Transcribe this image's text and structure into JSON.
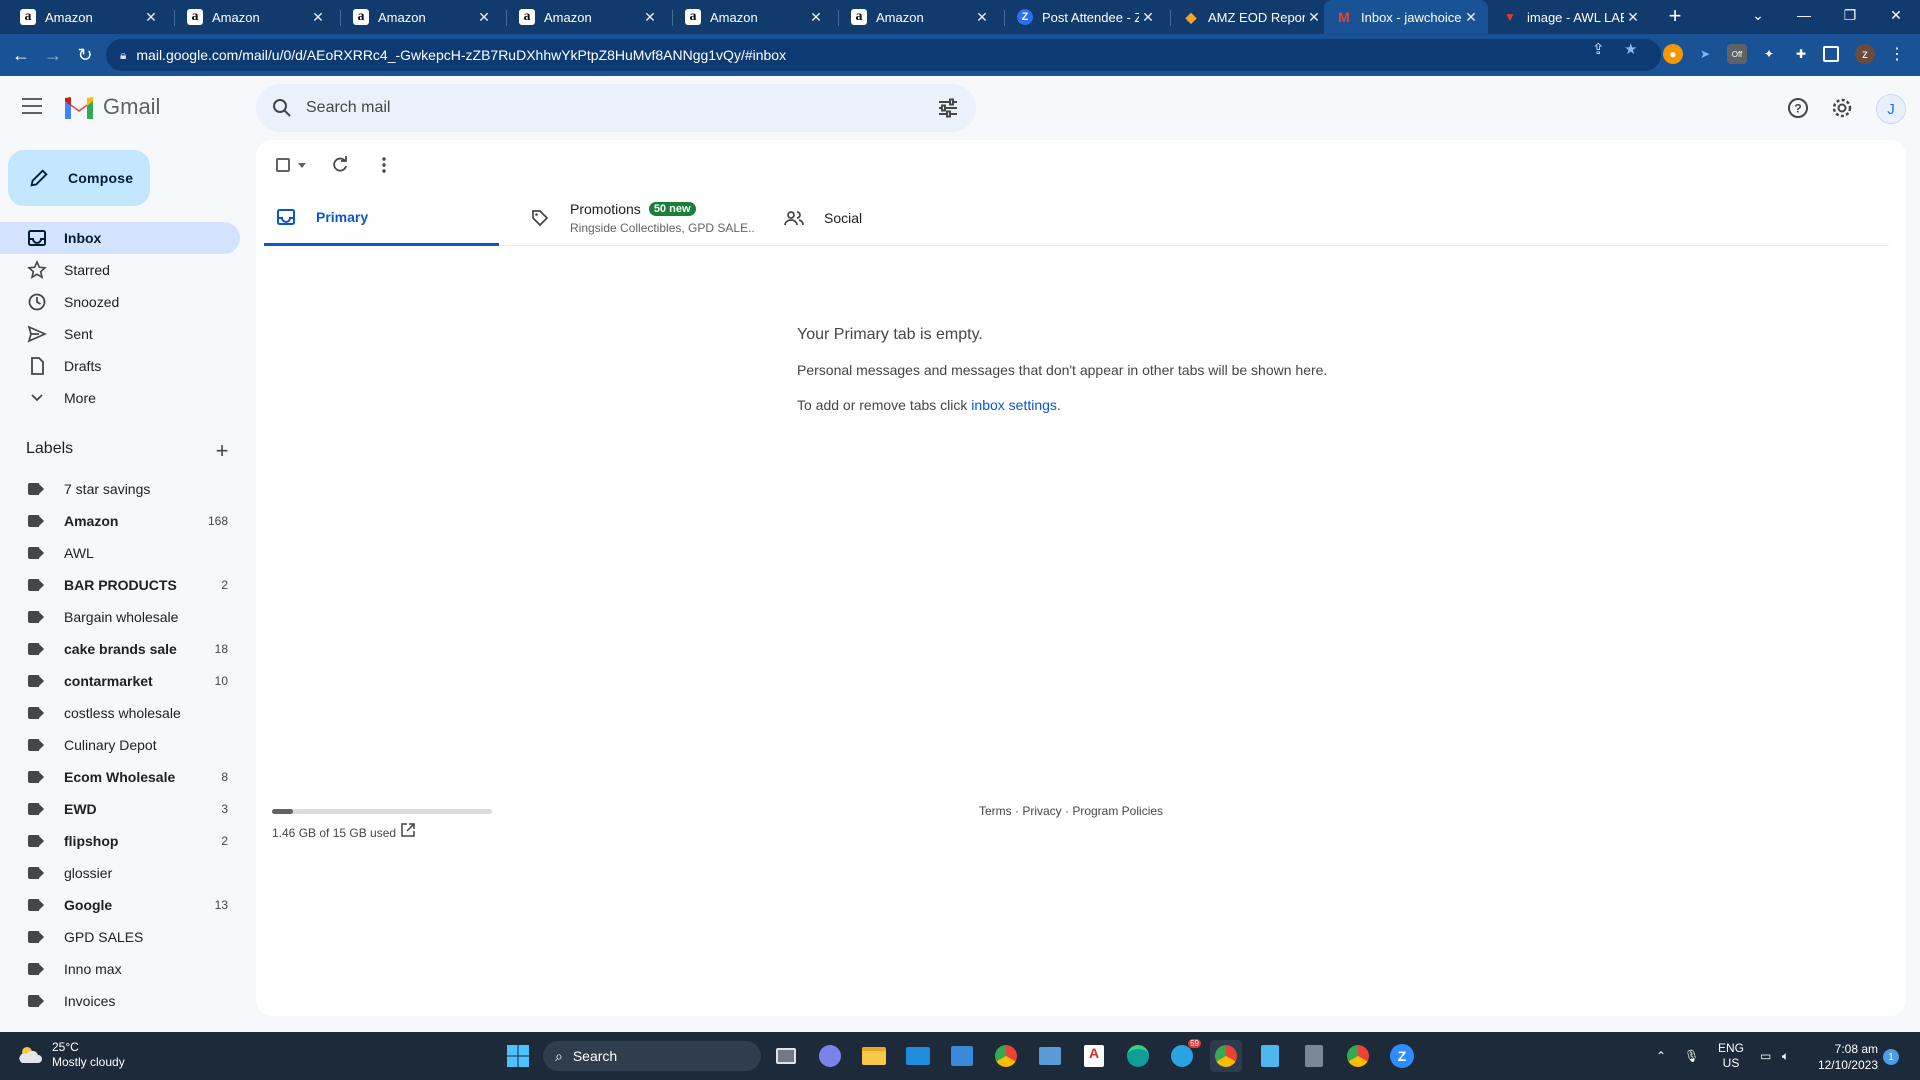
{
  "browser": {
    "tabs": [
      {
        "title": "Amazon",
        "icon": "amazon-icon"
      },
      {
        "title": "Amazon",
        "icon": "amazon-icon"
      },
      {
        "title": "Amazon",
        "icon": "amazon-icon"
      },
      {
        "title": "Amazon",
        "icon": "amazon-icon"
      },
      {
        "title": "Amazon",
        "icon": "amazon-icon"
      },
      {
        "title": "Amazon",
        "icon": "amazon-icon"
      },
      {
        "title": "Post Attendee - Zoho",
        "icon": "zoho-icon"
      },
      {
        "title": "AMZ EOD Report",
        "icon": "report-icon"
      },
      {
        "title": "Inbox - jawchoices",
        "icon": "gmail-icon",
        "active": true
      },
      {
        "title": "image - AWL LABEL",
        "icon": "image-icon"
      }
    ],
    "url": "mail.google.com/mail/u/0/d/AEoRXRRc4_-GwkepcH-zZB7RuDXhhwYkPtpZ8HuMvf8ANNgg1vQy/#inbox",
    "profile_initial": "z",
    "extension_badge": "Off"
  },
  "gmail": {
    "product_name": "Gmail",
    "search_placeholder": "Search mail",
    "avatar_initial": "J",
    "compose_label": "Compose",
    "nav": [
      {
        "label": "Inbox",
        "icon": "inbox-icon",
        "active": true
      },
      {
        "label": "Starred",
        "icon": "star-icon"
      },
      {
        "label": "Snoozed",
        "icon": "clock-icon"
      },
      {
        "label": "Sent",
        "icon": "send-icon"
      },
      {
        "label": "Drafts",
        "icon": "draft-icon"
      },
      {
        "label": "More",
        "icon": "chevron-down-icon"
      }
    ],
    "labels_heading": "Labels",
    "labels": [
      {
        "name": "7 star savings",
        "count": "",
        "bold": false
      },
      {
        "name": "Amazon",
        "count": "168",
        "bold": true
      },
      {
        "name": "AWL",
        "count": "",
        "bold": false
      },
      {
        "name": "BAR PRODUCTS",
        "count": "2",
        "bold": true
      },
      {
        "name": "Bargain wholesale",
        "count": "",
        "bold": false
      },
      {
        "name": "cake brands sale",
        "count": "18",
        "bold": true
      },
      {
        "name": "contarmarket",
        "count": "10",
        "bold": true
      },
      {
        "name": "costless wholesale",
        "count": "",
        "bold": false
      },
      {
        "name": "Culinary Depot",
        "count": "",
        "bold": false
      },
      {
        "name": "Ecom Wholesale",
        "count": "8",
        "bold": true
      },
      {
        "name": "EWD",
        "count": "3",
        "bold": true
      },
      {
        "name": "flipshop",
        "count": "2",
        "bold": true
      },
      {
        "name": "glossier",
        "count": "",
        "bold": false
      },
      {
        "name": "Google",
        "count": "13",
        "bold": true
      },
      {
        "name": "GPD SALES",
        "count": "",
        "bold": false
      },
      {
        "name": "Inno max",
        "count": "",
        "bold": false
      },
      {
        "name": "Invoices",
        "count": "",
        "bold": false
      }
    ],
    "tabs": {
      "primary": "Primary",
      "promotions": "Promotions",
      "promotions_badge": "50 new",
      "promotions_sub": "Ringside Collectibles, GPD SALE...",
      "social": "Social"
    },
    "empty": {
      "title": "Your Primary tab is empty.",
      "line1": "Personal messages and messages that don't appear in other tabs will be shown here.",
      "line2_prefix": "To add or remove tabs click ",
      "line2_link": "inbox settings",
      "line2_suffix": "."
    },
    "storage": {
      "text": "1.46 GB of 15 GB used",
      "fraction": 0.097
    },
    "footer": "Terms · Privacy · Program Policies"
  },
  "taskbar": {
    "weather_temp": "25°C",
    "weather_desc": "Mostly cloudy",
    "search_label": "Search",
    "lang_top": "ENG",
    "lang_bottom": "US",
    "time": "7:08 am",
    "date": "12/10/2023",
    "notifications": "1",
    "telegram_badge": "59"
  },
  "colors": {
    "browser_frame": "#113a6d",
    "browser_toolbar": "#1a5296",
    "compose_bg": "#c2e7ff",
    "active_nav": "#d3e3fd",
    "primary_accent": "#0b57d0",
    "promo_badge": "#188038"
  }
}
